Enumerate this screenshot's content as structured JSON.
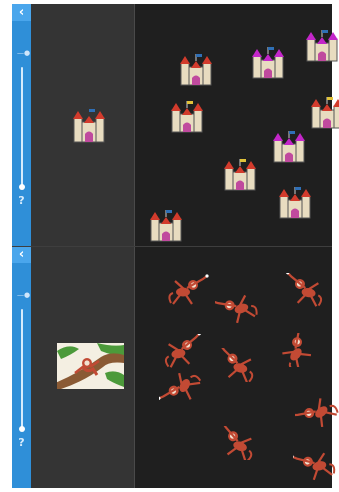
{
  "panels": [
    {
      "id": "castles",
      "rail": {
        "back_icon": "back-chevron-icon",
        "help_label": "?",
        "slider_level": 1.0
      },
      "thumbnail": {
        "icon": "castle-icon"
      },
      "sprite_icon": "castle-icon",
      "sprites": [
        {
          "flag_color": "#2f6fb6",
          "roof_color": "#d23b2c"
        },
        {
          "flag_color": "#2f6fb6",
          "roof_color": "#c326c9"
        },
        {
          "flag_color": "#2f6fb6",
          "roof_color": "#c326c9"
        },
        {
          "flag_color": "#e0c23a",
          "roof_color": "#d23b2c"
        },
        {
          "flag_color": "#e0c23a",
          "roof_color": "#d23b2c"
        },
        {
          "flag_color": "#2f6fb6",
          "roof_color": "#c326c9"
        },
        {
          "flag_color": "#e0c23a",
          "roof_color": "#d23b2c"
        },
        {
          "flag_color": "#2f6fb6",
          "roof_color": "#d23b2c"
        },
        {
          "flag_color": "#2f6fb6",
          "roof_color": "#d23b2c"
        }
      ]
    },
    {
      "id": "monkeys",
      "rail": {
        "back_icon": "back-chevron-icon",
        "help_label": "?",
        "slider_level": 1.0
      },
      "thumbnail": {
        "icon": "monkey-in-tree-photo"
      },
      "sprite_icon": "monkey-icon",
      "sprites": [
        {
          "pose": "a"
        },
        {
          "pose": "b"
        },
        {
          "pose": "c"
        },
        {
          "pose": "d"
        },
        {
          "pose": "e"
        },
        {
          "pose": "f"
        },
        {
          "pose": "g"
        },
        {
          "pose": "h"
        },
        {
          "pose": "i"
        },
        {
          "pose": "j"
        }
      ]
    }
  ],
  "colors": {
    "rail": "#2f8fd8",
    "rail_button": "#4aa6ec",
    "thumb_column": "#343434",
    "canvas": "#1f1f1f",
    "castle_wall": "#e8dcc0",
    "castle_door": "#c04a9e",
    "monkey_body": "#c24a34"
  }
}
